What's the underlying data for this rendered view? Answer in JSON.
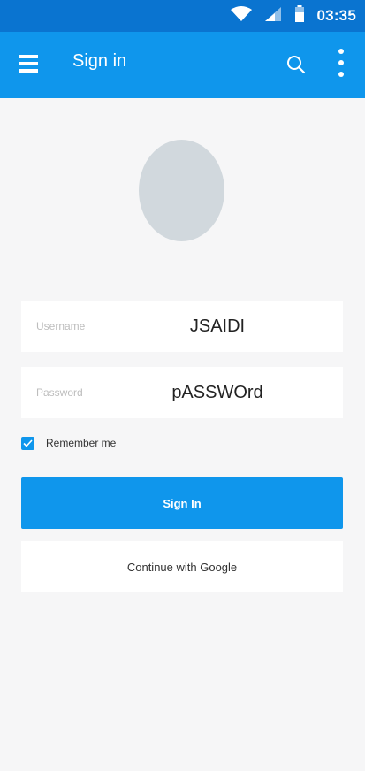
{
  "status_bar": {
    "time": "03:35",
    "icons": [
      "wifi-icon",
      "signal-icon",
      "battery-icon"
    ]
  },
  "app_bar": {
    "title": "Sign in",
    "icons": [
      "menu-icon",
      "search-icon",
      "more-vert-icon"
    ]
  },
  "form": {
    "username": {
      "label": "Username",
      "value": "JSAIDI"
    },
    "password": {
      "label": "Password",
      "value": "pASSWOrd"
    },
    "remember": {
      "label": "Remember me",
      "checked": true
    }
  },
  "buttons": {
    "sign_in": "Sign In",
    "google": "Continue with Google"
  },
  "colors": {
    "status_bar": "#0a74d0",
    "app_bar": "#0f96ec",
    "primary_button": "#0f96ec",
    "background": "#f6f6f7",
    "avatar": "#d1d8dd"
  }
}
